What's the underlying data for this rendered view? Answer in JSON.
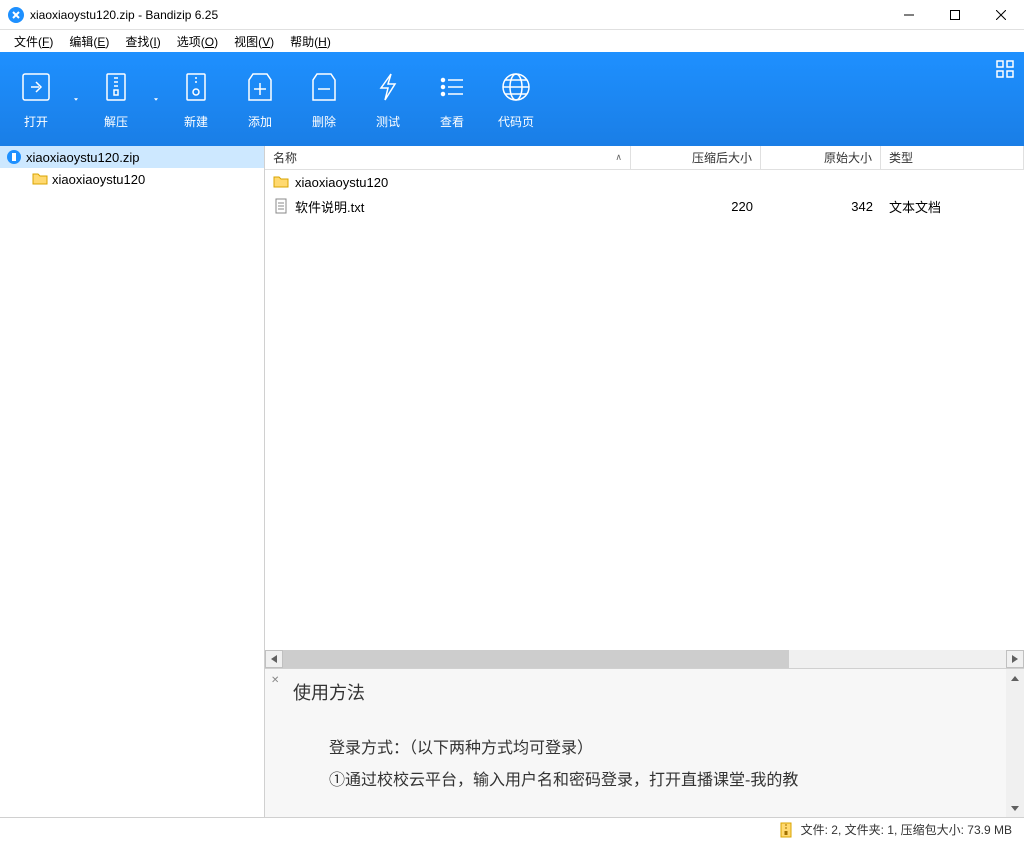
{
  "title": "xiaoxiaoystu120.zip - Bandizip 6.25",
  "menus": [
    {
      "label": "文件",
      "key": "F"
    },
    {
      "label": "编辑",
      "key": "E"
    },
    {
      "label": "查找",
      "key": "I"
    },
    {
      "label": "选项",
      "key": "O"
    },
    {
      "label": "视图",
      "key": "V"
    },
    {
      "label": "帮助",
      "key": "H"
    }
  ],
  "toolbar": [
    {
      "label": "打开",
      "icon": "open",
      "chevron": true
    },
    {
      "label": "解压",
      "icon": "extract",
      "chevron": true
    },
    {
      "label": "新建",
      "icon": "new",
      "chevron": false
    },
    {
      "label": "添加",
      "icon": "add",
      "chevron": false
    },
    {
      "label": "删除",
      "icon": "delete",
      "chevron": false
    },
    {
      "label": "测试",
      "icon": "test",
      "chevron": false
    },
    {
      "label": "查看",
      "icon": "view",
      "chevron": false
    },
    {
      "label": "代码页",
      "icon": "codepage",
      "chevron": false
    }
  ],
  "tree": {
    "root": {
      "label": "xiaoxiaoystu120.zip"
    },
    "child": {
      "label": "xiaoxiaoystu120"
    }
  },
  "columns": {
    "name": "名称",
    "compressed": "压缩后大小",
    "original": "原始大小",
    "type": "类型"
  },
  "rows": [
    {
      "name": "xiaoxiaoystu120",
      "compressed": "",
      "original": "",
      "type": "",
      "icon": "folder"
    },
    {
      "name": "软件说明.txt",
      "compressed": "220",
      "original": "342",
      "type": "文本文档",
      "icon": "txt"
    }
  ],
  "preview": {
    "title": "使用方法",
    "line1": "登录方式：（以下两种方式均可登录）",
    "line2": "①通过校校云平台，输入用户名和密码登录，打开直播课堂-我的教"
  },
  "status": "文件: 2, 文件夹: 1, 压缩包大小: 73.9 MB"
}
